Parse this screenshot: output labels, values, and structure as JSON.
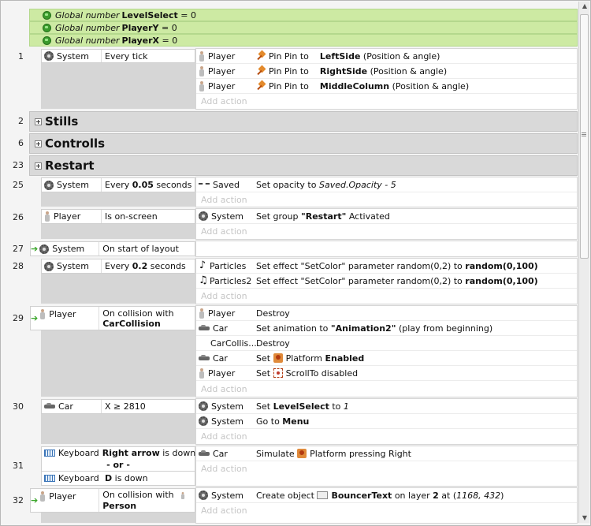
{
  "globals": [
    {
      "kind": "Global number",
      "name": "LevelSelect",
      "value": "= 0"
    },
    {
      "kind": "Global number",
      "name": "PlayerY",
      "value": "= 0"
    },
    {
      "kind": "Global number",
      "name": "PlayerX",
      "value": "= 0"
    }
  ],
  "add_action": "Add action",
  "groups": {
    "stills": "Stills",
    "controlls": "Controlls",
    "restart": "Restart"
  },
  "ln": {
    "e1": "1",
    "g2": "2",
    "g6": "6",
    "g23": "23",
    "e25": "25",
    "e26": "26",
    "e27": "27",
    "e28": "28",
    "e29": "29",
    "e30": "30",
    "e31": "31",
    "e32": "32"
  },
  "e1": {
    "cond_obj": "System",
    "cond": "Every tick",
    "a1": {
      "obj": "Player",
      "verb": "Pin Pin to",
      "target": "LeftSide",
      "tail": "(Position & angle)"
    },
    "a2": {
      "obj": "Player",
      "verb": "Pin Pin to",
      "target": "RightSide",
      "tail": "(Position & angle)"
    },
    "a3": {
      "obj": "Player",
      "verb": "Pin Pin to",
      "target": "MiddleColumn",
      "tail": "(Position & angle)"
    }
  },
  "e25": {
    "cond_obj": "System",
    "c_a": "Every",
    "c_b": "0.05",
    "c_c": "seconds",
    "a1": {
      "obj": "Saved",
      "t_a": "Set opacity to",
      "t_b": "Saved.Opacity - 5"
    }
  },
  "e26": {
    "cond_obj": "Player",
    "cond": "Is on-screen",
    "a1": {
      "obj": "System",
      "t_a": "Set group",
      "t_b": "\"Restart\"",
      "t_c": "Activated"
    }
  },
  "e27": {
    "cond_obj": "System",
    "cond": "On start of layout"
  },
  "e28": {
    "cond_obj": "System",
    "c_a": "Every",
    "c_b": "0.2",
    "c_c": "seconds",
    "a1": {
      "obj": "Particles",
      "t_a": "Set effect \"SetColor\" parameter random(0,2) to",
      "t_b": "random(0,100)"
    },
    "a2": {
      "obj": "Particles2",
      "t_a": "Set effect \"SetColor\" parameter random(0,2) to",
      "t_b": "random(0,100)"
    }
  },
  "e29": {
    "cond_obj": "Player",
    "c1": "On collision with",
    "c2": "CarCollision",
    "a1": {
      "obj": "Player",
      "t": "Destroy"
    },
    "a2": {
      "obj": "Car",
      "t_a": "Set animation to",
      "t_b": "\"Animation2\"",
      "t_c": "(play from beginning)"
    },
    "a3": {
      "obj": "CarCollis...",
      "t": "Destroy"
    },
    "a4": {
      "obj": "Car",
      "t_a": "Set",
      "t_b": "Platform",
      "t_c": "Enabled"
    },
    "a5": {
      "obj": "Player",
      "t_a": "Set",
      "t_b": "ScrollTo disabled"
    }
  },
  "e30": {
    "cond_obj": "Car",
    "cond": "X ≥ 2810",
    "a1": {
      "obj": "System",
      "t_a": "Set",
      "t_b": "LevelSelect",
      "t_c": "to",
      "t_d": "1"
    },
    "a2": {
      "obj": "System",
      "t_a": "Go to",
      "t_b": "Menu"
    }
  },
  "e31": {
    "c1_obj": "Keyboard",
    "c1_a": "Right arrow",
    "c1_b": "is down",
    "or": "- or -",
    "c2_obj": "Keyboard",
    "c2_a": "D",
    "c2_b": "is down",
    "a1": {
      "obj": "Car",
      "t_a": "Simulate",
      "t_b": "Platform pressing Right"
    }
  },
  "e32": {
    "cond_obj": "Player",
    "c1": "On collision with",
    "c2": "Person",
    "a1": {
      "obj": "System",
      "t_a": "Create object",
      "t_b": "BouncerText",
      "t_c": "on layer",
      "t_d": "2",
      "t_e": "at (",
      "t_f": "1168, 432",
      "t_g": ")"
    }
  }
}
